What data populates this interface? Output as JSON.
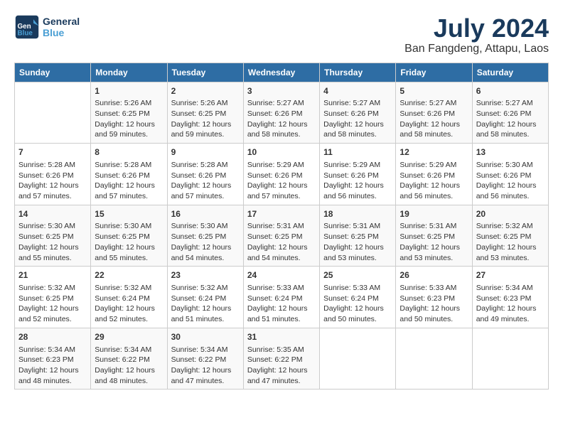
{
  "header": {
    "logo_line1": "General",
    "logo_line2": "Blue",
    "title": "July 2024",
    "subtitle": "Ban Fangdeng, Attapu, Laos"
  },
  "days_of_week": [
    "Sunday",
    "Monday",
    "Tuesday",
    "Wednesday",
    "Thursday",
    "Friday",
    "Saturday"
  ],
  "weeks": [
    [
      {
        "day": "",
        "content": ""
      },
      {
        "day": "1",
        "content": "Sunrise: 5:26 AM\nSunset: 6:25 PM\nDaylight: 12 hours\nand 59 minutes."
      },
      {
        "day": "2",
        "content": "Sunrise: 5:26 AM\nSunset: 6:25 PM\nDaylight: 12 hours\nand 59 minutes."
      },
      {
        "day": "3",
        "content": "Sunrise: 5:27 AM\nSunset: 6:26 PM\nDaylight: 12 hours\nand 58 minutes."
      },
      {
        "day": "4",
        "content": "Sunrise: 5:27 AM\nSunset: 6:26 PM\nDaylight: 12 hours\nand 58 minutes."
      },
      {
        "day": "5",
        "content": "Sunrise: 5:27 AM\nSunset: 6:26 PM\nDaylight: 12 hours\nand 58 minutes."
      },
      {
        "day": "6",
        "content": "Sunrise: 5:27 AM\nSunset: 6:26 PM\nDaylight: 12 hours\nand 58 minutes."
      }
    ],
    [
      {
        "day": "7",
        "content": "Sunrise: 5:28 AM\nSunset: 6:26 PM\nDaylight: 12 hours\nand 57 minutes."
      },
      {
        "day": "8",
        "content": "Sunrise: 5:28 AM\nSunset: 6:26 PM\nDaylight: 12 hours\nand 57 minutes."
      },
      {
        "day": "9",
        "content": "Sunrise: 5:28 AM\nSunset: 6:26 PM\nDaylight: 12 hours\nand 57 minutes."
      },
      {
        "day": "10",
        "content": "Sunrise: 5:29 AM\nSunset: 6:26 PM\nDaylight: 12 hours\nand 57 minutes."
      },
      {
        "day": "11",
        "content": "Sunrise: 5:29 AM\nSunset: 6:26 PM\nDaylight: 12 hours\nand 56 minutes."
      },
      {
        "day": "12",
        "content": "Sunrise: 5:29 AM\nSunset: 6:26 PM\nDaylight: 12 hours\nand 56 minutes."
      },
      {
        "day": "13",
        "content": "Sunrise: 5:30 AM\nSunset: 6:26 PM\nDaylight: 12 hours\nand 56 minutes."
      }
    ],
    [
      {
        "day": "14",
        "content": "Sunrise: 5:30 AM\nSunset: 6:25 PM\nDaylight: 12 hours\nand 55 minutes."
      },
      {
        "day": "15",
        "content": "Sunrise: 5:30 AM\nSunset: 6:25 PM\nDaylight: 12 hours\nand 55 minutes."
      },
      {
        "day": "16",
        "content": "Sunrise: 5:30 AM\nSunset: 6:25 PM\nDaylight: 12 hours\nand 54 minutes."
      },
      {
        "day": "17",
        "content": "Sunrise: 5:31 AM\nSunset: 6:25 PM\nDaylight: 12 hours\nand 54 minutes."
      },
      {
        "day": "18",
        "content": "Sunrise: 5:31 AM\nSunset: 6:25 PM\nDaylight: 12 hours\nand 53 minutes."
      },
      {
        "day": "19",
        "content": "Sunrise: 5:31 AM\nSunset: 6:25 PM\nDaylight: 12 hours\nand 53 minutes."
      },
      {
        "day": "20",
        "content": "Sunrise: 5:32 AM\nSunset: 6:25 PM\nDaylight: 12 hours\nand 53 minutes."
      }
    ],
    [
      {
        "day": "21",
        "content": "Sunrise: 5:32 AM\nSunset: 6:25 PM\nDaylight: 12 hours\nand 52 minutes."
      },
      {
        "day": "22",
        "content": "Sunrise: 5:32 AM\nSunset: 6:24 PM\nDaylight: 12 hours\nand 52 minutes."
      },
      {
        "day": "23",
        "content": "Sunrise: 5:32 AM\nSunset: 6:24 PM\nDaylight: 12 hours\nand 51 minutes."
      },
      {
        "day": "24",
        "content": "Sunrise: 5:33 AM\nSunset: 6:24 PM\nDaylight: 12 hours\nand 51 minutes."
      },
      {
        "day": "25",
        "content": "Sunrise: 5:33 AM\nSunset: 6:24 PM\nDaylight: 12 hours\nand 50 minutes."
      },
      {
        "day": "26",
        "content": "Sunrise: 5:33 AM\nSunset: 6:23 PM\nDaylight: 12 hours\nand 50 minutes."
      },
      {
        "day": "27",
        "content": "Sunrise: 5:34 AM\nSunset: 6:23 PM\nDaylight: 12 hours\nand 49 minutes."
      }
    ],
    [
      {
        "day": "28",
        "content": "Sunrise: 5:34 AM\nSunset: 6:23 PM\nDaylight: 12 hours\nand 48 minutes."
      },
      {
        "day": "29",
        "content": "Sunrise: 5:34 AM\nSunset: 6:22 PM\nDaylight: 12 hours\nand 48 minutes."
      },
      {
        "day": "30",
        "content": "Sunrise: 5:34 AM\nSunset: 6:22 PM\nDaylight: 12 hours\nand 47 minutes."
      },
      {
        "day": "31",
        "content": "Sunrise: 5:35 AM\nSunset: 6:22 PM\nDaylight: 12 hours\nand 47 minutes."
      },
      {
        "day": "",
        "content": ""
      },
      {
        "day": "",
        "content": ""
      },
      {
        "day": "",
        "content": ""
      }
    ]
  ]
}
